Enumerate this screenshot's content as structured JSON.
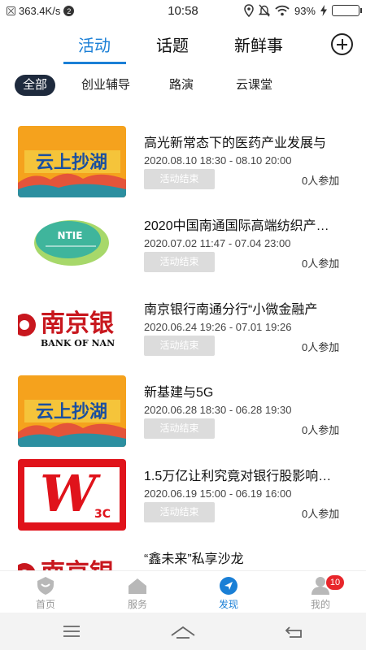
{
  "status_bar": {
    "speed": "363.4K/s",
    "notif_count": "2",
    "time": "10:58",
    "battery": "93%"
  },
  "top_tabs": [
    "活动",
    "话题",
    "新鲜事"
  ],
  "sub_tabs": [
    "全部",
    "创业辅导",
    "路演",
    "云课堂"
  ],
  "events": [
    {
      "title": "高光新常态下的医药产业发展与",
      "date": "2020.08.10 18:30 - 08.10 20:00",
      "status": "活动结束",
      "count": "0人参加",
      "thumb_text": "云上抄湖",
      "thumb_type": "cloud"
    },
    {
      "title": "2020中国南通国际高端纺织产…",
      "date": "2020.07.02 11:47 - 07.04 23:00",
      "status": "活动结束",
      "count": "0人参加",
      "thumb_text": "NTIE",
      "thumb_type": "ntie"
    },
    {
      "title": "南京银行南通分行“小微金融产",
      "date": "2020.06.24 19:26 - 07.01 19:26",
      "status": "活动结束",
      "count": "0人参加",
      "thumb_text": "南京银",
      "thumb_sub": "BANK OF NAN",
      "thumb_type": "bank"
    },
    {
      "title": "新基建与5G",
      "date": "2020.06.28 18:30 - 06.28 19:30",
      "status": "活动结束",
      "count": "0人参加",
      "thumb_text": "云上抄湖",
      "thumb_type": "cloud"
    },
    {
      "title": "1.5万亿让利究竟对银行股影响…",
      "date": "2020.06.19 15:00 - 06.19 16:00",
      "status": "活动结束",
      "count": "0人参加",
      "thumb_text": "W",
      "thumb_sub": "3C",
      "thumb_type": "w3c"
    },
    {
      "title": "“鑫未来”私享沙龙",
      "date": "",
      "status": "",
      "count": "",
      "thumb_text": "南京银",
      "thumb_type": "bank"
    }
  ],
  "bottom_nav": [
    {
      "label": "首页",
      "icon": "home-icon"
    },
    {
      "label": "服务",
      "icon": "service-icon"
    },
    {
      "label": "发现",
      "icon": "discover-icon"
    },
    {
      "label": "我的",
      "icon": "profile-icon",
      "badge": "10"
    }
  ],
  "colors": {
    "accent": "#1a7fd6",
    "chip_active_bg": "#1e2a3d",
    "status_bg": "#dcdcdc",
    "badge": "#e8262b"
  }
}
